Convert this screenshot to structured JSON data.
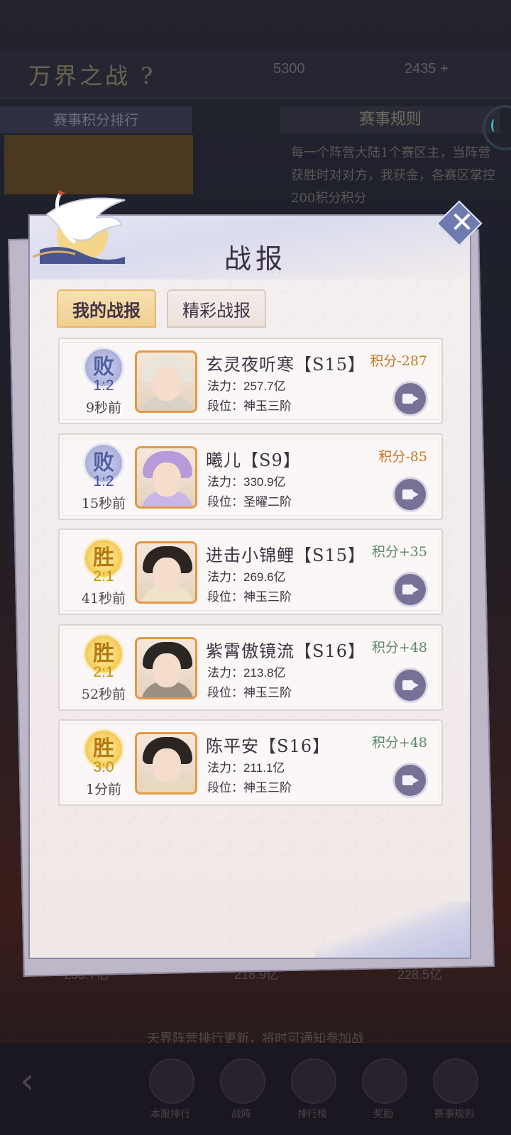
{
  "background": {
    "game_title": "万界之战 ?",
    "resource_1": "5300",
    "resource_2": "2435 +",
    "left_header": "赛事积分排行",
    "right_header": "赛事规则",
    "rules_text": "每一个阵营大陆1个赛区主，当阵营获胜时对对方，我获金，各赛区掌控200积分积分",
    "footer_text": "天界阵营排行更新，将时可通知参加战",
    "values": [
      "233.7亿",
      "218.9亿",
      "228.5亿"
    ],
    "nav_labels": [
      "本服排行",
      "战阵",
      "排行榜",
      "奖励",
      "赛事规则"
    ]
  },
  "panel": {
    "title": "战报",
    "title_deco": "· · · · · · · ·",
    "close_label": "✕",
    "tabs": [
      {
        "label": "我的战报",
        "active": true
      },
      {
        "label": "精彩战报",
        "active": false
      }
    ],
    "power_label": "法力：",
    "rank_label": "段位：",
    "records": [
      {
        "result": "败",
        "outcome": "lose",
        "score": "1:2",
        "time": "9秒前",
        "name": "玄灵夜听寒【S15】",
        "power": "257.7亿",
        "rank": "神玉三阶",
        "points": "积分-287",
        "points_sign": "neg",
        "hair_color": "#e9e4dc",
        "body_color": "#d8d2c6"
      },
      {
        "result": "败",
        "outcome": "lose",
        "score": "1:2",
        "time": "15秒前",
        "name": "曦儿【S9】",
        "power": "330.9亿",
        "rank": "圣曜二阶",
        "points": "积分-85",
        "points_sign": "neg",
        "hair_color": "#b79ad8",
        "body_color": "#c9b6e6"
      },
      {
        "result": "胜",
        "outcome": "win",
        "score": "2:1",
        "time": "41秒前",
        "name": "进击小锦鲤【S15】",
        "power": "269.6亿",
        "rank": "神玉三阶",
        "points": "积分+35",
        "points_sign": "pos",
        "hair_color": "#2c2420",
        "body_color": "#efe3c8"
      },
      {
        "result": "胜",
        "outcome": "win",
        "score": "2:1",
        "time": "52秒前",
        "name": "紫霄傲镜流【S16】",
        "power": "213.8亿",
        "rank": "神玉三阶",
        "points": "积分+48",
        "points_sign": "pos",
        "hair_color": "#2a2624",
        "body_color": "#9b8f82"
      },
      {
        "result": "胜",
        "outcome": "win",
        "score": "3:0",
        "time": "1分前",
        "name": "陈平安【S16】",
        "power": "211.1亿",
        "rank": "神玉三阶",
        "points": "积分+48",
        "points_sign": "pos",
        "hair_color": "#2b2522",
        "body_color": "#e7dcc2"
      }
    ]
  },
  "colors": {
    "lose_text": "#3f4f97",
    "win_text": "#c08f15",
    "points_negative": "#c7761e",
    "points_positive": "#5b8a6a",
    "avatar_border": "#e59845",
    "tab_active": "#f0cf90"
  },
  "icons": {
    "close": "close-icon",
    "replay": "video-replay-icon",
    "crane": "crane-emblem"
  }
}
